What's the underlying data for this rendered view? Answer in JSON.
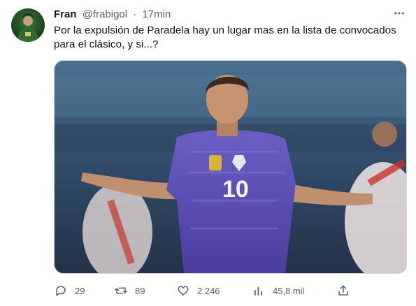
{
  "tweet": {
    "author": {
      "display_name": "Fran",
      "handle": "@frabigol"
    },
    "separator": "·",
    "time": "17min",
    "text": "Por la expulsión de Paradela hay un lugar mas en la lista de convocados\npara el clásico, y si...?",
    "media": {
      "description_icon": "photo"
    },
    "actions": {
      "replies": "29",
      "retweets": "89",
      "likes": "2.246",
      "views": "45,8 mil"
    }
  },
  "colors": {
    "text_primary": "#0f1419",
    "text_secondary": "#536471",
    "border": "#cfd9de",
    "jersey_purple": "#5d4fb0"
  },
  "icons": {
    "more": "more-horizontal-icon",
    "reply": "reply-icon",
    "retweet": "retweet-icon",
    "like": "heart-icon",
    "views": "bar-chart-icon",
    "share": "share-icon"
  }
}
